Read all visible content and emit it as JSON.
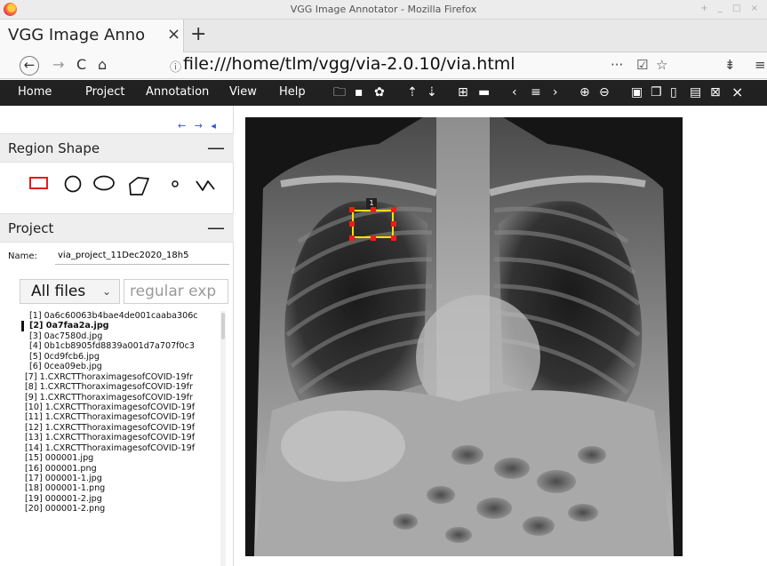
{
  "window": {
    "title": "VGG Image Annotator - Mozilla Firefox",
    "controls": "+ _ □ ×"
  },
  "tab": {
    "title": "VGG Image Anno",
    "close": "×",
    "new_tab": "+"
  },
  "navbar": {
    "back": "←",
    "forward": "→",
    "reload": "C",
    "home": "⌂",
    "info": "ⓘ",
    "url": "file:///home/tlm/vgg/via-2.0.10/via.html",
    "more": "···",
    "pocket": "☑",
    "bookmark": "☆",
    "library": "⇟",
    "menu": "≡"
  },
  "menubar": {
    "items": [
      "Home",
      "Project",
      "Annotation",
      "View",
      "Help"
    ],
    "tool_icons": [
      "folder-icon",
      "save-icon",
      "gear-icon",
      "upload-icon",
      "download-icon",
      "grid-icon",
      "comment-icon",
      "prev-icon",
      "list-icon",
      "next-icon",
      "zoom-in-icon",
      "zoom-out-icon",
      "select-all-icon",
      "copy-icon",
      "paste-icon",
      "paste-special-icon",
      "delete-icon",
      "close-icon"
    ],
    "glyphs": {
      "folder": "🗀",
      "save": "▪",
      "gear": "✿",
      "upload": "⇡",
      "download": "⇣",
      "grid": "⊞",
      "comment": "▬",
      "prev": "‹",
      "list": "≡",
      "next": "›",
      "zoom_in": "⊕",
      "zoom_out": "⊖",
      "select_all": "▣",
      "copy": "❐",
      "paste": "▯",
      "paste_special": "▤",
      "delete": "⊠",
      "close": "×"
    }
  },
  "leftpanel": {
    "arrows": "← → ◂",
    "region_shape": {
      "title": "Region Shape",
      "toggle": "—"
    },
    "shapes": [
      "rect-shape",
      "circle-shape",
      "ellipse-shape",
      "polygon-shape",
      "point-shape",
      "polyline-shape"
    ],
    "project": {
      "title": "Project",
      "toggle": "—"
    },
    "name_label": "Name:",
    "project_name": "via_project_11Dec2020_18h5",
    "filter_select": "All files",
    "filter_chevron": "⌄",
    "filter_placeholder": "regular exp",
    "files": [
      "[1] 0a6c60063b4bae4de001caaba306c",
      "[2] 0a7faa2a.jpg",
      "[3] 0ac7580d.jpg",
      "[4] 0b1cb8905fd8839a001d7a707f0c3",
      "[5] 0cd9fcb6.jpg",
      "[6] 0cea09eb.jpg",
      "[7] 1.CXRCTThoraximagesofCOVID-19fr",
      "[8] 1.CXRCTThoraximagesofCOVID-19fr",
      "[9] 1.CXRCTThoraximagesofCOVID-19fr",
      "[10] 1.CXRCTThoraximagesofCOVID-19f",
      "[11] 1.CXRCTThoraximagesofCOVID-19f",
      "[12] 1.CXRCTThoraximagesofCOVID-19f",
      "[13] 1.CXRCTThoraximagesofCOVID-19f",
      "[14] 1.CXRCTThoraximagesofCOVID-19f",
      "[15] 000001.jpg",
      "[16] 000001.png",
      "[17] 000001-1.jpg",
      "[18] 000001-1.png",
      "[19] 000001-2.jpg",
      "[20] 000001-2.png"
    ],
    "active_file_index": 1
  },
  "canvas": {
    "region_label": "1",
    "colors": {
      "region_border": "#ffe100",
      "region_handle": "#ee1c1c",
      "menubar_bg": "#212121"
    }
  }
}
